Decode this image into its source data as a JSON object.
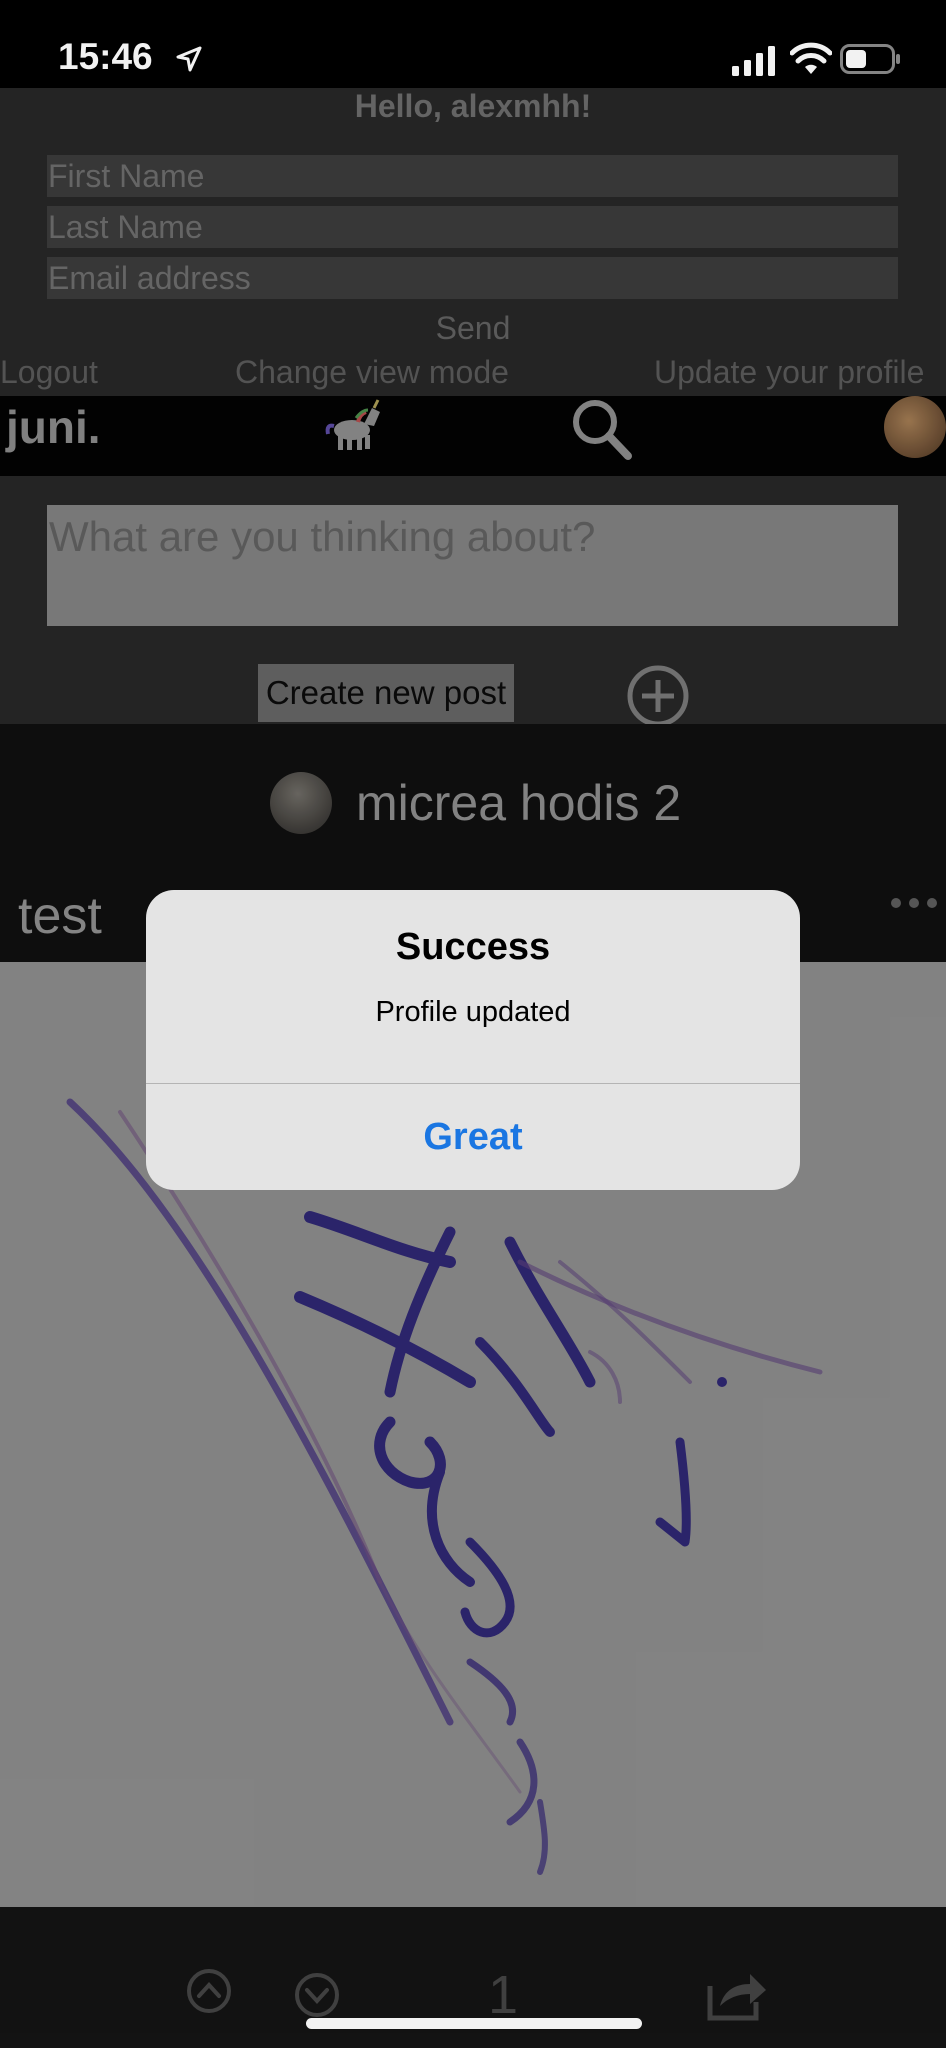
{
  "status_bar": {
    "time": "15:46"
  },
  "profile": {
    "greeting": "Hello, alexmhh!",
    "first_name_placeholder": "First Name",
    "last_name_placeholder": "Last Name",
    "email_placeholder": "Email address",
    "send_label": "Send",
    "logout_label": "Logout",
    "change_view_label": "Change view mode",
    "update_profile_label": "Update your profile"
  },
  "navbar": {
    "logo": "juni.",
    "icons": [
      "unicorn-icon",
      "search-icon",
      "avatar"
    ]
  },
  "composer": {
    "placeholder": "What are you thinking about?",
    "create_label": "Create new post"
  },
  "post": {
    "author": "micrea hodis 2",
    "title": "test",
    "votes": "1"
  },
  "alert": {
    "title": "Success",
    "message": "Profile updated",
    "button": "Great",
    "button_color": "#1a76e2"
  }
}
